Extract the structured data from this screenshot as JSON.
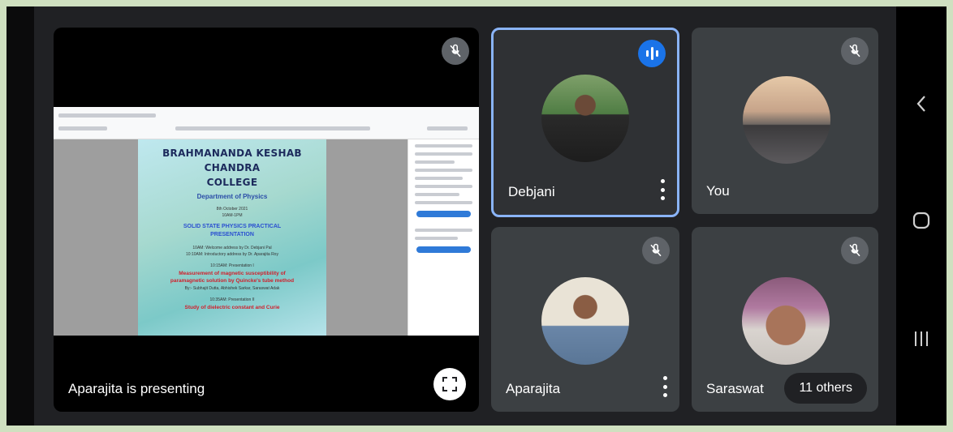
{
  "presentation": {
    "presenting_label": "Aparajita is presenting",
    "slide": {
      "title_line1": "BRAHMANANDA KESHAB CHANDRA",
      "title_line2": "COLLEGE",
      "department": "Department of Physics",
      "date_line": "8th October 2021",
      "time_line": "10AM-1PM",
      "event_title_line1": "SOLID STATE PHYSICS PRACTICAL",
      "event_title_line2": "PRESENTATION",
      "agenda_1": "10AM: Welcome address by Dr. Debjani Pal",
      "agenda_2": "10:10AM: Introductory address by Dr. Aparajita Roy",
      "session_1": "10:15AM: Presentation I",
      "topic_1a": "Measurement of magnetic susceptibility of",
      "topic_1b": "paramagnetic solution by Quincke's tube method",
      "presenters_1": "By:- Subhajit Dutta, Abhishek Sarkar, Saraswat Adak",
      "session_2": "10:35AM: Presentation II",
      "topic_2": "Study of dielectric constant and Curie"
    }
  },
  "participants": [
    {
      "name": "Debjani",
      "speaking": true,
      "muted": false
    },
    {
      "name": "You",
      "speaking": false,
      "muted": true
    },
    {
      "name": "Aparajita",
      "speaking": false,
      "muted": true
    },
    {
      "name": "Saraswat",
      "speaking": false,
      "muted": true
    }
  ],
  "others_chip": "11 others",
  "icons": {
    "mic_off": "mic-off-icon",
    "speaking": "audio-level-icon",
    "expand": "fullscreen-icon",
    "more": "more-vert-icon",
    "back": "back-icon",
    "home": "home-icon",
    "recents": "recents-icon"
  },
  "colors": {
    "tile": "#3c4043",
    "background": "#202124",
    "active_border": "#8ab4f8",
    "speaking": "#1a73e8"
  }
}
